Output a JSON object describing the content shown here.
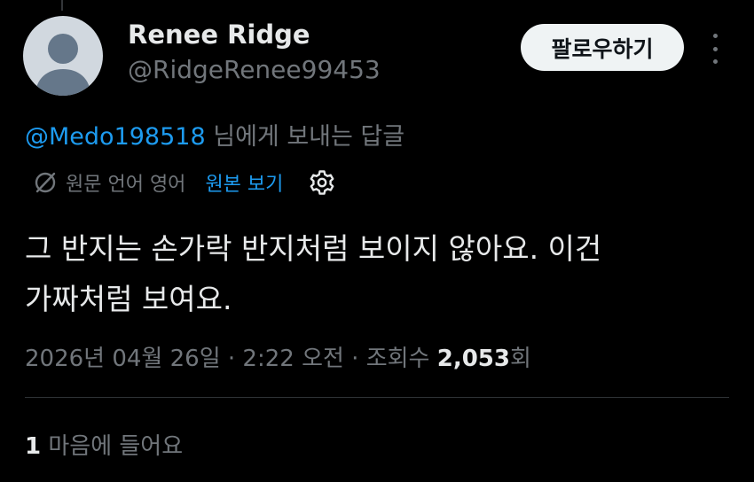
{
  "author": {
    "display_name": "Renee Ridge",
    "handle": "@RidgeRenee99453",
    "avatar_icon": "default-user-avatar"
  },
  "follow_button": {
    "label": "팔로우하기"
  },
  "more_button": {
    "icon": "more-vertical-icon"
  },
  "reply_context": {
    "mention": "@Medo198518",
    "suffix": " 님에게 보내는 답글"
  },
  "translation": {
    "icon": "globe-icon",
    "original_language_label": "원문 언어 영어",
    "view_original_label": "원본 보기",
    "settings_icon": "gear-icon"
  },
  "tweet": {
    "lines": [
      "그 반지는 손가락 반지처럼 보이지 않아요. 이건",
      "가짜처럼 보여요."
    ]
  },
  "meta": {
    "timestamp": "2026년 04월 26일 · 2:22 오전 · 조회수 ",
    "views_count": "2,053",
    "views_suffix": "회"
  },
  "engagement": {
    "likes_count": "1",
    "likes_label": " 마음에 들어요"
  },
  "colors": {
    "background": "#000000",
    "text_primary": "#e7e9ea",
    "text_secondary": "#71767b",
    "accent_link": "#1d9bf0",
    "follow_button_bg": "#eff3f4",
    "divider": "#2f3336"
  }
}
